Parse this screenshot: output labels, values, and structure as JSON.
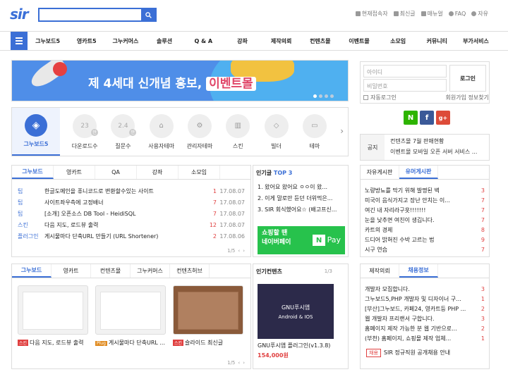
{
  "header": {
    "logo": "sir",
    "search_placeholder": "",
    "links": [
      "현재접속자",
      "최신글",
      "매뉴얼",
      "FAQ",
      "자유"
    ]
  },
  "nav": [
    "그누보드5",
    "영카트5",
    "그누커머스",
    "솔루션",
    "Q & A",
    "강좌",
    "제작의뢰",
    "컨텐츠몰",
    "이벤트몰",
    "소모임",
    "커뮤니티",
    "부가서비스"
  ],
  "banner": {
    "text": "제 4세대 신개념 홍보,",
    "highlight": "이벤트몰"
  },
  "login": {
    "id_placeholder": "아이디",
    "pw_placeholder": "비밀번호",
    "button": "로그인",
    "autologin": "자동로그인",
    "join": "회원가입",
    "find": "정보찾기"
  },
  "social": [
    "N",
    "f",
    "g+"
  ],
  "iconrow": {
    "first": "그누보드5",
    "items": [
      {
        "label": "다운로드수",
        "value": "23",
        "unit": "만"
      },
      {
        "label": "질문수",
        "value": "2.4",
        "unit": "만"
      },
      {
        "label": "사용자테마",
        "value": "",
        "unit": ""
      },
      {
        "label": "관리자테마",
        "value": "",
        "unit": ""
      },
      {
        "label": "스킨",
        "value": "",
        "unit": ""
      },
      {
        "label": "빌더",
        "value": "",
        "unit": ""
      },
      {
        "label": "테마",
        "value": "",
        "unit": ""
      }
    ]
  },
  "notice": {
    "label": "공지",
    "lines": [
      "컨텐츠몰 7월 판매현황",
      "이벤트몰 모바일 오픈 서버 서비스 ..."
    ]
  },
  "board1": {
    "tabs": [
      "그누보드",
      "영카트",
      "QA",
      "강좌",
      "소모임"
    ],
    "rows": [
      {
        "cat": "팁",
        "title": "한글도메인을 퓨니코드로 변환할수있는 사이트",
        "n": "1",
        "date": "17.08.07"
      },
      {
        "cat": "팁",
        "title": "사이트좌우측에 고정배너",
        "n": "7",
        "date": "17.08.07"
      },
      {
        "cat": "팁",
        "title": "[소개] 오픈소스 DB Tool - HeidiSQL",
        "n": "7",
        "date": "17.08.07"
      },
      {
        "cat": "스킨",
        "title": "다음 지도, 로드뷰 출력",
        "n": "12",
        "date": "17.08.07"
      },
      {
        "cat": "플러그인",
        "title": "게시물마다 단축URL 만들기 (URL Shortener)",
        "n": "2",
        "date": "17.08.06"
      }
    ],
    "pager": "1/5"
  },
  "popular": {
    "title": "인기글",
    "top": "TOP 3",
    "items": [
      "1. 왔어요 왔어요 ㅇㅇ이 왔...",
      "2. 이게 말로만 듣던 더위먹은...",
      "3. SIR 회식했어요☆ (배고프신..."
    ],
    "pay_lines": [
      "쇼핑할 땐",
      "네이버페이"
    ],
    "pay_n": "N",
    "pay_word": "Pay"
  },
  "free": {
    "tabs": [
      "자유게시판",
      "유머게시판"
    ],
    "rows": [
      {
        "t": "노량방뇨를 막기 위해 발명된 벽",
        "n": "3"
      },
      {
        "t": "미국이 음식가지고 장난 안치는 이...",
        "n": "7"
      },
      {
        "t": "여긴 내 자리라구욧!!!!!!!",
        "n": "7"
      },
      {
        "t": "눈을 낮추면 여친이 생깁니다.",
        "n": "7"
      },
      {
        "t": "카트의 경제",
        "n": "8"
      },
      {
        "t": "드디어 밝혀진 수박 고르는 법",
        "n": "9"
      },
      {
        "t": "시구 연습",
        "n": "7"
      }
    ]
  },
  "gallery": {
    "tabs": [
      "그누보드",
      "영카트",
      "컨텐츠몰",
      "그누커머스",
      "컨텐츠허브"
    ],
    "items": [
      {
        "badge": "스킨",
        "title": "다음 지도, 로드뷰 출력",
        "color": "#e04040"
      },
      {
        "badge": "Plug",
        "title": "게시물마다 단축URL ...",
        "color": "#e08b20"
      },
      {
        "badge": "스킨",
        "title": "슬라이드 최신글",
        "color": "#e04040"
      }
    ],
    "pager": "1/5"
  },
  "popc": {
    "title": "인기컨텐츠",
    "pager": "1/3",
    "img_title": "GNU푸시앱",
    "img_sub": "Android & IOS",
    "caption": "GNU푸시앱 플러그인(v1.3.8)",
    "price": "154,000원"
  },
  "jobs": {
    "tabs": [
      "제작의뢰",
      "채용정보"
    ],
    "rows": [
      {
        "t": "개발자 모집합니다.",
        "n": "3"
      },
      {
        "t": "그누보드5,PHP 개발자 및 디자이너 구...",
        "n": "1"
      },
      {
        "t": "[부산]그누보드, 카페24, 영카트등 PHP ...",
        "n": "2"
      },
      {
        "t": "웹 개발자 프리랜서 구합니다.",
        "n": "3"
      },
      {
        "t": "홈페이지 제작 가능한 분 웹 기반으로...",
        "n": "2"
      },
      {
        "t": "(부천) 홈페이지, 쇼핑몰 제작 업체...",
        "n": "1"
      }
    ],
    "foot_tag": "채용",
    "foot_text": "SIR 정규직원 공개채용 안내"
  }
}
